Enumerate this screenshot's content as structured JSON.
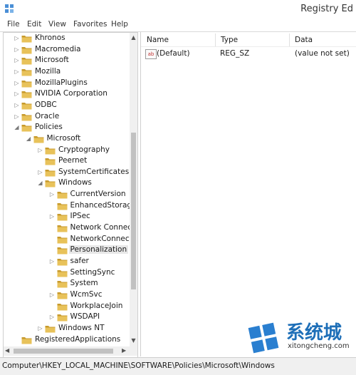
{
  "window": {
    "title": "Registry Ed"
  },
  "menu": [
    "File",
    "Edit",
    "View",
    "Favorites",
    "Help"
  ],
  "tree": [
    {
      "label": "Khronos",
      "level": 1,
      "arrow": "collapsed"
    },
    {
      "label": "Macromedia",
      "level": 1,
      "arrow": "collapsed"
    },
    {
      "label": "Microsoft",
      "level": 1,
      "arrow": "collapsed"
    },
    {
      "label": "Mozilla",
      "level": 1,
      "arrow": "collapsed"
    },
    {
      "label": "MozillaPlugins",
      "level": 1,
      "arrow": "collapsed"
    },
    {
      "label": "NVIDIA Corporation",
      "level": 1,
      "arrow": "collapsed"
    },
    {
      "label": "ODBC",
      "level": 1,
      "arrow": "collapsed"
    },
    {
      "label": "Oracle",
      "level": 1,
      "arrow": "collapsed"
    },
    {
      "label": "Policies",
      "level": 1,
      "arrow": "expanded"
    },
    {
      "label": "Microsoft",
      "level": 2,
      "arrow": "expanded"
    },
    {
      "label": "Cryptography",
      "level": 3,
      "arrow": "collapsed"
    },
    {
      "label": "Peernet",
      "level": 3,
      "arrow": "none"
    },
    {
      "label": "SystemCertificates",
      "level": 3,
      "arrow": "collapsed"
    },
    {
      "label": "Windows",
      "level": 3,
      "arrow": "expanded"
    },
    {
      "label": "CurrentVersion",
      "level": 4,
      "arrow": "collapsed"
    },
    {
      "label": "EnhancedStorage",
      "level": 4,
      "arrow": "none"
    },
    {
      "label": "IPSec",
      "level": 4,
      "arrow": "collapsed"
    },
    {
      "label": "Network Connec",
      "level": 4,
      "arrow": "none"
    },
    {
      "label": "NetworkConnect",
      "level": 4,
      "arrow": "none"
    },
    {
      "label": "Personalization",
      "level": 4,
      "arrow": "none",
      "selected": true
    },
    {
      "label": "safer",
      "level": 4,
      "arrow": "collapsed"
    },
    {
      "label": "SettingSync",
      "level": 4,
      "arrow": "none"
    },
    {
      "label": "System",
      "level": 4,
      "arrow": "none"
    },
    {
      "label": "WcmSvc",
      "level": 4,
      "arrow": "collapsed"
    },
    {
      "label": "WorkplaceJoin",
      "level": 4,
      "arrow": "none"
    },
    {
      "label": "WSDAPI",
      "level": 4,
      "arrow": "collapsed"
    },
    {
      "label": "Windows NT",
      "level": 3,
      "arrow": "collapsed"
    },
    {
      "label": "RegisteredApplications",
      "level": 1,
      "arrow": "none"
    }
  ],
  "columns": {
    "name": "Name",
    "type": "Type",
    "data": "Data"
  },
  "values": [
    {
      "icon_text": "ab",
      "name": "(Default)",
      "type": "REG_SZ",
      "data": "(value not set)"
    }
  ],
  "statusbar": {
    "path": "Computer\\HKEY_LOCAL_MACHINE\\SOFTWARE\\Policies\\Microsoft\\Windows"
  },
  "watermark": {
    "brand": "系统城",
    "url": "xitongcheng.com"
  },
  "colors": {
    "folder": "#e8c25a",
    "folder_dark": "#c79a2c",
    "watermark_blue": "#1e6fb8"
  }
}
